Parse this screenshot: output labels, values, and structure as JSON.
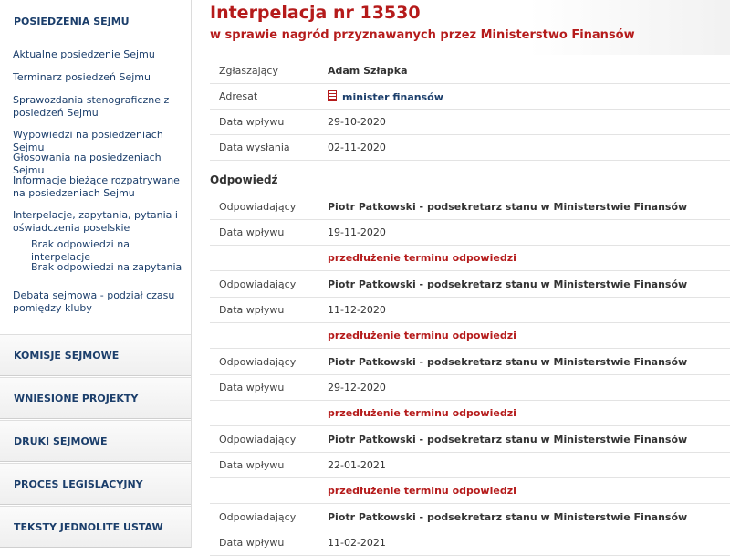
{
  "sidebar": {
    "heading": "POSIEDZENIA SEJMU",
    "links": [
      "Aktualne posiedzenie Sejmu",
      "Terminarz posiedzeń Sejmu",
      "Sprawozdania stenograficzne z posiedzeń Sejmu",
      "Wypowiedzi na posiedzeniach Sejmu",
      "Głosowania na posiedzeniach Sejmu",
      "Informacje bieżące rozpatrywane na posiedzeniach Sejmu",
      "Interpelacje, zapytania, pytania i oświadczenia poselskie",
      "Brak odpowiedzi na interpelacje",
      "Brak odpowiedzi na zapytania",
      "Debata sejmowa - podział czasu pomiędzy kluby"
    ],
    "sections": [
      "KOMISJE SEJMOWE",
      "WNIESIONE PROJEKTY",
      "DRUKI SEJMOWE",
      "PROCES LEGISLACYJNY",
      "TEKSTY JEDNOLITE USTAW"
    ]
  },
  "main": {
    "title": "Interpelacja nr 13530",
    "subtitle": "w sprawie nagród przyznawanych przez Ministerstwo Finansów",
    "details": [
      {
        "label": "Zgłaszający",
        "value": "Adam Szłapka"
      },
      {
        "label": "Adresat",
        "value": "minister finansów"
      },
      {
        "label": "Data wpływu",
        "value": "29-10-2020"
      },
      {
        "label": "Data wysłania",
        "value": "02-11-2020"
      }
    ],
    "answer_heading": "Odpowiedź",
    "responder_label": "Odpowiadający",
    "date_label": "Data wpływu",
    "extension_text": "przedłużenie terminu odpowiedzi",
    "answers": [
      {
        "responder": "Piotr Patkowski - podsekretarz stanu w Ministerstwie Finansów",
        "date": "19-11-2020"
      },
      {
        "responder": "Piotr Patkowski - podsekretarz stanu w Ministerstwie Finansów",
        "date": "11-12-2020"
      },
      {
        "responder": "Piotr Patkowski - podsekretarz stanu w Ministerstwie Finansów",
        "date": "29-12-2020"
      },
      {
        "responder": "Piotr Patkowski - podsekretarz stanu w Ministerstwie Finansów",
        "date": "22-01-2021"
      },
      {
        "responder": "Piotr Patkowski - podsekretarz stanu w Ministerstwie Finansów",
        "date": "11-02-2021"
      }
    ]
  },
  "colors": {
    "accent_red": "#b51b1b",
    "nav_blue": "#1b3e6b"
  },
  "icons": {
    "addressee": "document-icon"
  }
}
